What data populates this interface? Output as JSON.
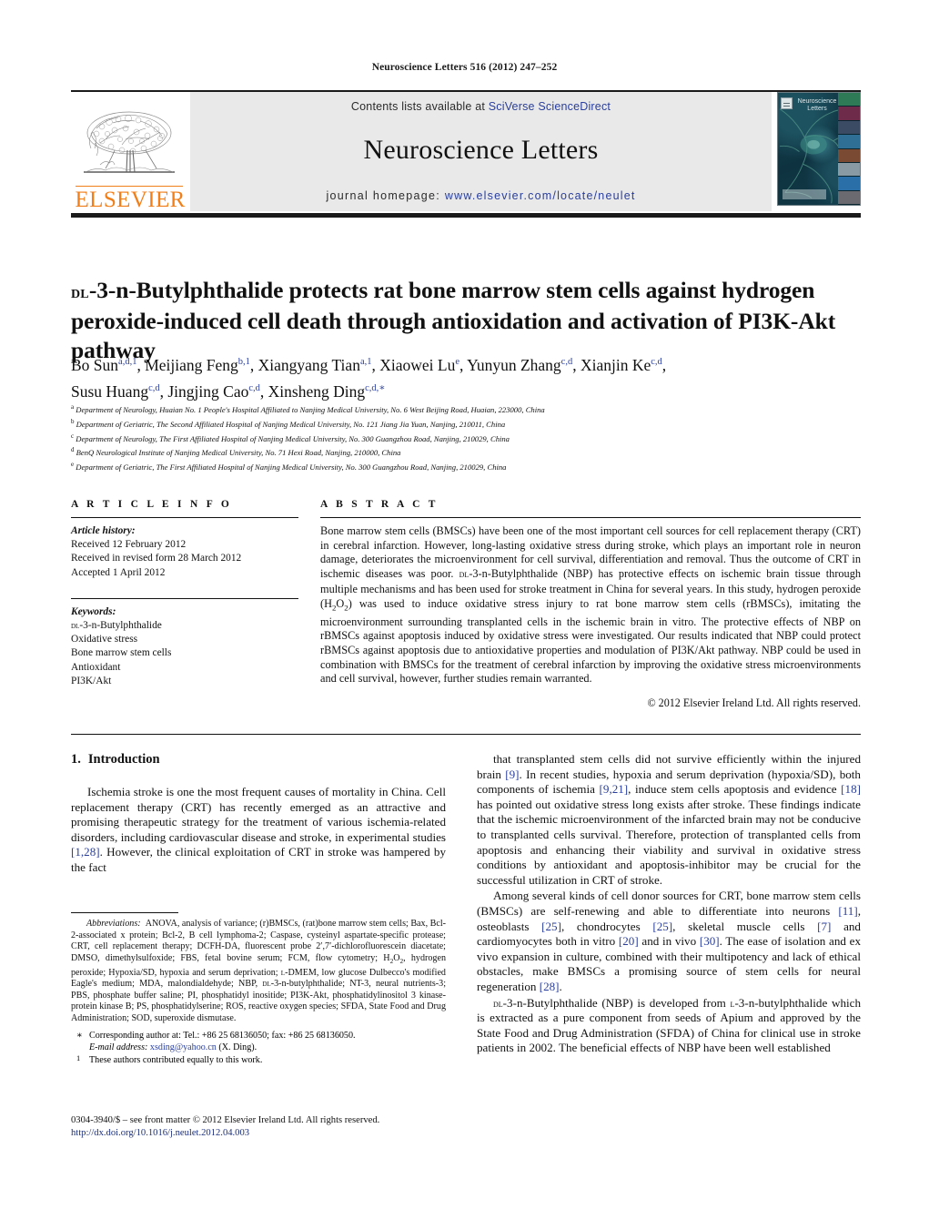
{
  "running_head": "Neuroscience Letters 516 (2012) 247–252",
  "masthead": {
    "publisher_name": "ELSEVIER",
    "contents_prefix": "Contents lists available at ",
    "contents_link": "SciVerse ScienceDirect",
    "journal_name": "Neuroscience Letters",
    "homepage_prefix": "journal homepage: ",
    "homepage_url": "www.elsevier.com/locate/neulet",
    "cover_title_line1": "Neuroscience",
    "cover_title_line2": "Letters"
  },
  "article": {
    "title_smallcaps": "DL",
    "title_rest": "-3-n-Butylphthalide protects rat bone marrow stem cells against hydrogen peroxide-induced cell death through antioxidation and activation of PI3K-Akt pathway",
    "authors": [
      {
        "name": "Bo Sun",
        "sup": "a,d,1"
      },
      {
        "name": "Meijiang Feng",
        "sup": "b,1"
      },
      {
        "name": "Xiangyang Tian",
        "sup": "a,1"
      },
      {
        "name": "Xiaowei Lu",
        "sup": "e"
      },
      {
        "name": "Yunyun Zhang",
        "sup": "c,d"
      },
      {
        "name": "Xianjin Ke",
        "sup": "c,d"
      },
      {
        "name": "Susu Huang",
        "sup": "c,d"
      },
      {
        "name": "Jingjing Cao",
        "sup": "c,d"
      },
      {
        "name": "Xinsheng Ding",
        "sup": "c,d,∗"
      }
    ],
    "affiliations": [
      {
        "mark": "a",
        "text": "Department of Neurology, Huaian No. 1 People's Hospital Affiliated to Nanjing Medical University, No. 6 West Beijing Road, Huaian, 223000, China"
      },
      {
        "mark": "b",
        "text": "Department of Geriatric, The Second Affiliated Hospital of Nanjing Medical University, No. 121 Jiang Jia Yuan, Nanjing, 210011, China"
      },
      {
        "mark": "c",
        "text": "Department of Neurology, The First Affiliated Hospital of Nanjing Medical University, No. 300 Guangzhou Road, Nanjing, 210029, China"
      },
      {
        "mark": "d",
        "text": "BenQ Neurological Institute of Nanjing Medical University, No. 71 Hexi Road, Nanjing, 210000, China"
      },
      {
        "mark": "e",
        "text": "Department of Geriatric, The First Affiliated Hospital of Nanjing Medical University, No. 300 Guangzhou Road, Nanjing, 210029, China"
      }
    ]
  },
  "article_info": {
    "heading": "A R T I C L E  I N F O",
    "history_label": "Article history:",
    "history": [
      "Received 12 February 2012",
      "Received in revised form 28 March 2012",
      "Accepted 1 April 2012"
    ],
    "keywords_label": "Keywords:",
    "keywords": [
      "DL-3-n-Butylphthalide",
      "Oxidative stress",
      "Bone marrow stem cells",
      "Antioxidant",
      "PI3K/Akt"
    ]
  },
  "abstract": {
    "heading": "A B S T R A C T",
    "text": "Bone marrow stem cells (BMSCs) have been one of the most important cell sources for cell replacement therapy (CRT) in cerebral infarction. However, long-lasting oxidative stress during stroke, which plays an important role in neuron damage, deteriorates the microenvironment for cell survival, differentiation and removal. Thus the outcome of CRT in ischemic diseases was poor. DL-3-n-Butylphthalide (NBP) has protective effects on ischemic brain tissue through multiple mechanisms and has been used for stroke treatment in China for several years. In this study, hydrogen peroxide (H2O2) was used to induce oxidative stress injury to rat bone marrow stem cells (rBMSCs), imitating the microenvironment surrounding transplanted cells in the ischemic brain in vitro. The protective effects of NBP on rBMSCs against apoptosis induced by oxidative stress were investigated. Our results indicated that NBP could protect rBMSCs against apoptosis due to antioxidative properties and modulation of PI3K/Akt pathway. NBP could be used in combination with BMSCs for the treatment of cerebral infarction by improving the oxidative stress microenvironments and cell survival, however, further studies remain warranted.",
    "copyright": "© 2012 Elsevier Ireland Ltd. All rights reserved."
  },
  "body": {
    "section_number": "1.",
    "section_title": "Introduction",
    "left_paragraph": "Ischemia stroke is one the most frequent causes of mortality in China. Cell replacement therapy (CRT) has recently emerged as an attractive and promising therapeutic strategy for the treatment of various ischemia-related disorders, including cardiovascular disease and stroke, in experimental studies [1,28]. However, the clinical exploitation of CRT in stroke was hampered by the fact",
    "right_paragraph_1": "that transplanted stem cells did not survive efficiently within the injured brain [9]. In recent studies, hypoxia and serum deprivation (hypoxia/SD), both components of ischemia [9,21], induce stem cells apoptosis and evidence [18] has pointed out oxidative stress long exists after stroke. These findings indicate that the ischemic microenvironment of the infarcted brain may not be conducive to transplanted cells survival. Therefore, protection of transplanted cells from apoptosis and enhancing their viability and survival in oxidative stress conditions by antioxidant and apoptosis-inhibitor may be crucial for the successful utilization in CRT of stroke.",
    "right_paragraph_2": "Among several kinds of cell donor sources for CRT, bone marrow stem cells (BMSCs) are self-renewing and able to differentiate into neurons [11], osteoblasts [25], chondrocytes [25], skeletal muscle cells [7] and cardiomyocytes both in vitro [20] and in vivo [30]. The ease of isolation and ex vivo expansion in culture, combined with their multipotency and lack of ethical obstacles, make BMSCs a promising source of stem cells for neural regeneration [28].",
    "right_paragraph_3": "DL-3-n-Butylphthalide (NBP) is developed from L-3-n-butylphthalide which is extracted as a pure component from seeds of Apium and approved by the State Food and Drug Administration (SFDA) of China for clinical use in stroke patients in 2002. The beneficial effects of NBP have been well established"
  },
  "footnote": {
    "abbrev_label": "Abbreviations:",
    "abbrev_text": "ANOVA, analysis of variance; (r)BMSCs, (rat)bone marrow stem cells; Bax, Bcl-2-associated x protein; Bcl-2, B cell lymphoma-2; Caspase, cysteinyl aspartate-specific protease; CRT, cell replacement therapy; DCFH-DA, fluorescent probe 2′,7′-dichlorofluorescein diacetate; DMSO, dimethylsulfoxide; FBS, fetal bovine serum; FCM, flow cytometry; H2O2, hydrogen peroxide; Hypoxia/SD, hypoxia and serum deprivation; L-DMEM, low glucose Dulbecco's modified Eagle's medium; MDA, malondialdehyde; NBP, DL-3-n-butylphthalide; NT-3, neural nutrients-3; PBS, phosphate buffer saline; PI, phosphatidyl inositide; PI3K-Akt, phosphatidylinositol 3 kinase-protein kinase B; PS, phosphatidylserine; ROS, reactive oxygen species; SFDA, State Food and Drug Administration; SOD, superoxide dismutase.",
    "corresponding_mark": "∗",
    "corresponding_text": "Corresponding author at: Tel.: +86 25 68136050; fax: +86 25 68136050.",
    "email_label": "E-mail address:",
    "email": "xsding@yahoo.cn",
    "email_suffix": "(X. Ding).",
    "equal_mark": "1",
    "equal_text": "These authors contributed equally to this work."
  },
  "bottom_matter": {
    "issn_line": "0304-3940/$ – see front matter © 2012 Elsevier Ireland Ltd. All rights reserved.",
    "doi": "http://dx.doi.org/10.1016/j.neulet.2012.04.003"
  },
  "colors": {
    "link_blue": "#2a3f9d",
    "elsevier_orange": "#f07f1a",
    "band_grey": "#e9e9e9",
    "rule_black": "#1b1b1b"
  }
}
